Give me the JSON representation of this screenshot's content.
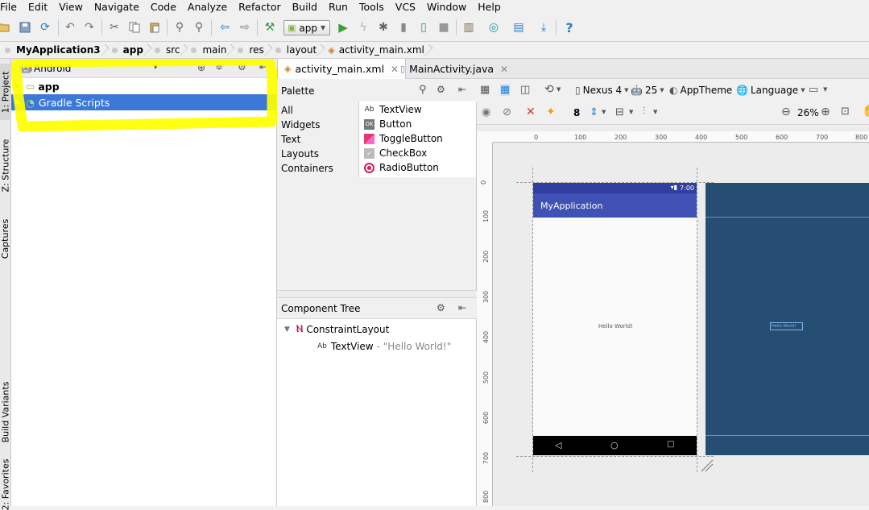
{
  "menu": [
    "File",
    "Edit",
    "View",
    "Navigate",
    "Code",
    "Analyze",
    "Refactor",
    "Build",
    "Run",
    "Tools",
    "VCS",
    "Window",
    "Help"
  ],
  "toolbar": {
    "run_config": "app",
    "help_label": "?"
  },
  "breadcrumb": [
    "MyApplication3",
    "app",
    "src",
    "main",
    "res",
    "layout",
    "activity_main.xml"
  ],
  "left_tabs": {
    "project": "1: Project",
    "structure": "Z: Structure",
    "captures": "Captures",
    "build_variants": "Build Variants",
    "favorites": "2: Favorites"
  },
  "project": {
    "view_mode": "Android",
    "items": [
      {
        "label": "app",
        "selected": false
      },
      {
        "label": "Gradle Scripts",
        "selected": true
      }
    ]
  },
  "editor_tabs": [
    {
      "label": "activity_main.xml",
      "active": true
    },
    {
      "label": "MainActivity.java",
      "active": false
    }
  ],
  "palette": {
    "title": "Palette",
    "categories": [
      "All",
      "Widgets",
      "Text",
      "Layouts",
      "Containers"
    ],
    "items": [
      {
        "label": "TextView",
        "icon": "Ab"
      },
      {
        "label": "Button",
        "icon": "OK"
      },
      {
        "label": "ToggleButton",
        "icon": "toggle"
      },
      {
        "label": "CheckBox",
        "icon": "check"
      },
      {
        "label": "RadioButton",
        "icon": "radio"
      }
    ]
  },
  "component_tree": {
    "title": "Component Tree",
    "root": "ConstraintLayout",
    "child_icon": "Ab",
    "child_name": "TextView",
    "child_text": "- \"Hello World!\""
  },
  "design": {
    "device": "Nexus 4",
    "api": "25",
    "theme": "AppTheme",
    "language": "Language",
    "margin_value": "8",
    "zoom": "26%"
  },
  "ruler": {
    "top": [
      "0",
      "100",
      "200",
      "300",
      "400",
      "500",
      "600",
      "700",
      "800"
    ],
    "left": [
      "0",
      "100",
      "200",
      "300",
      "400",
      "500",
      "600",
      "700",
      "800"
    ]
  },
  "phone": {
    "time": "7:00",
    "app_title": "MyApplication",
    "hello": "Hello World!",
    "blueprint_hello": "Hello World!"
  },
  "colors": {
    "selection": "#3b78d8",
    "app_bar": "#3f51b5",
    "status_bar": "#303f9f",
    "blueprint": "#264e72",
    "highlighter": "#ffff00"
  }
}
